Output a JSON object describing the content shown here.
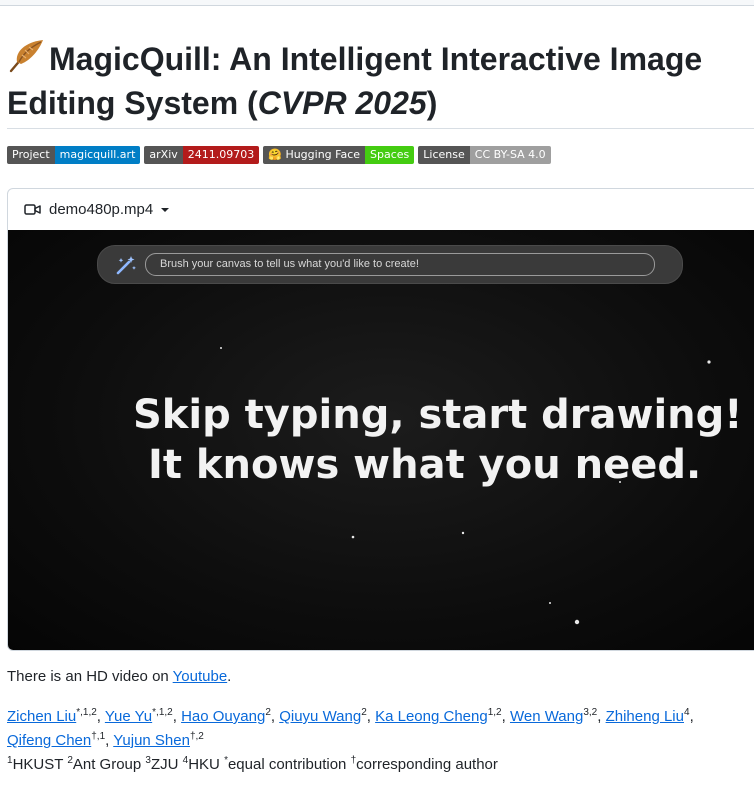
{
  "title": {
    "emoji": "🪶",
    "main": "MagicQuill: An Intelligent Interactive Image Editing System (",
    "venue": "CVPR 2025",
    "close": ")"
  },
  "badges": [
    {
      "left": "Project",
      "right": "magicquill.art",
      "left_color": "#555555",
      "right_color": "#007ec6"
    },
    {
      "left": "arXiv",
      "right": "2411.09703",
      "left_color": "#555555",
      "right_color": "#b31b1b"
    },
    {
      "left": "🤗 Hugging Face",
      "right": "Spaces",
      "left_color": "#555555",
      "right_color": "#44cc11"
    },
    {
      "left": "License",
      "right": "CC BY-SA 4.0",
      "left_color": "#555555",
      "right_color": "#9f9f9f"
    }
  ],
  "video": {
    "filename": "demo480p.mp4",
    "prompt_placeholder": "Brush your canvas to tell us what you'd like to create!",
    "handwriting_line1": "Skip typing, start drawing!",
    "handwriting_line2": "It knows what you need."
  },
  "hd_note": {
    "before": "There is an HD video on ",
    "link": "Youtube",
    "after": "."
  },
  "authors": [
    {
      "name": "Zichen Liu",
      "sup": "*,1,2"
    },
    {
      "name": "Yue Yu",
      "sup": "*,1,2"
    },
    {
      "name": "Hao Ouyang",
      "sup": "2"
    },
    {
      "name": "Qiuyu Wang",
      "sup": "2"
    },
    {
      "name": "Ka Leong Cheng",
      "sup": "1,2"
    },
    {
      "name": "Wen Wang",
      "sup": "3,2"
    },
    {
      "name": "Zhiheng Liu",
      "sup": "4"
    },
    {
      "name": "Qifeng Chen",
      "sup": "†,1"
    },
    {
      "name": "Yujun Shen",
      "sup": "†,2"
    }
  ],
  "affiliations": [
    {
      "sup": "1",
      "text": "HKUST"
    },
    {
      "sup": "2",
      "text": "Ant Group"
    },
    {
      "sup": "3",
      "text": "ZJU"
    },
    {
      "sup": "4",
      "text": "HKU"
    },
    {
      "sup": "*",
      "text": "equal contribution"
    },
    {
      "sup": "†",
      "text": "corresponding author"
    }
  ],
  "colors": {
    "link": "#0969da",
    "text": "#1f2328"
  }
}
